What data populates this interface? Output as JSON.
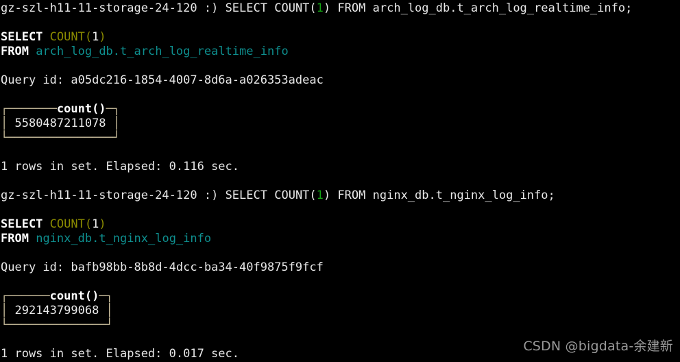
{
  "terminal": {
    "background_color": "#000000",
    "foreground_color": "#e8e8e8",
    "prompt_host": "gz-szl-h11-11-storage-24-120",
    "prompt_symbol": ":)"
  },
  "colors": {
    "keyword": "#ffffff",
    "function": "#8a8a00",
    "identifier": "#0e8f8f",
    "number_green": "#12a112",
    "number_white": "#f0f0f0",
    "box_border": "#cbbf9e",
    "watermark": "#9a9a9a"
  },
  "sessions": [
    {
      "prompt": {
        "host": "gz-szl-h11-11-storage-24-120",
        "symbol": ":)",
        "cmd_select": "SELECT",
        "cmd_count": "COUNT",
        "cmd_paren_open": "(",
        "cmd_arg": "1",
        "cmd_paren_close": ")",
        "cmd_from": "FROM",
        "cmd_table": "arch_log_db.t_arch_log_realtime_info",
        "cmd_terminator": ";"
      },
      "echo": {
        "select": "SELECT",
        "count": "COUNT",
        "paren_open": "(",
        "arg": "1",
        "paren_close": ")",
        "from": "FROM",
        "db": "arch_log_db",
        "dot": ".",
        "table": "t_arch_log_realtime_info"
      },
      "query_id_label": "Query id:",
      "query_id": "a05dc216-1854-4007-8d6a-a026353adeac",
      "result": {
        "column_header": "count()",
        "value": "5580487211078",
        "inner_width": 15
      },
      "status": "1 rows in set. Elapsed: 0.116 sec."
    },
    {
      "prompt": {
        "host": "gz-szl-h11-11-storage-24-120",
        "symbol": ":)",
        "cmd_select": "SELECT",
        "cmd_count": "COUNT",
        "cmd_paren_open": "(",
        "cmd_arg": "1",
        "cmd_paren_close": ")",
        "cmd_from": "FROM",
        "cmd_table": "nginx_db.t_nginx_log_info",
        "cmd_terminator": ";"
      },
      "echo": {
        "select": "SELECT",
        "count": "COUNT",
        "paren_open": "(",
        "arg": "1",
        "paren_close": ")",
        "from": "FROM",
        "db": "nginx_db",
        "dot": ".",
        "table": "t_nginx_log_info"
      },
      "query_id_label": "Query id:",
      "query_id": "bafb98bb-8b8d-4dcc-ba34-40f9875f9fcf",
      "result": {
        "column_header": "count()",
        "value": "292143799068",
        "inner_width": 14
      },
      "status": "1 rows in set. Elapsed: 0.017 sec."
    }
  ],
  "watermark": {
    "text": "CSDN @bigdata-余建新"
  },
  "box_chars": {
    "top_left": "┌",
    "top_right": "┐",
    "bottom_left": "└",
    "bottom_right": "┘",
    "horizontal": "─",
    "vertical": "│"
  }
}
